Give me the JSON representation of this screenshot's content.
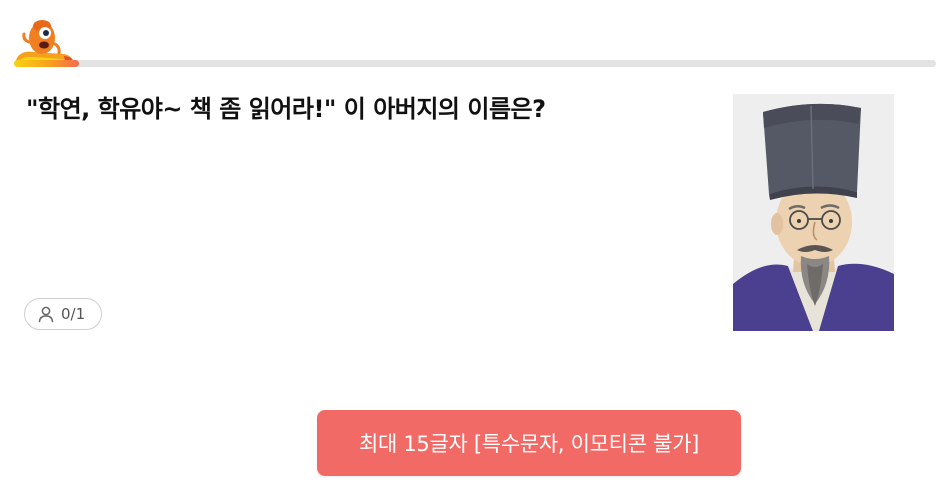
{
  "header": {
    "mascot_icon": "mascot-character-icon",
    "progress": {
      "value": 0.07,
      "colors": [
        "#f8d313",
        "#f7a01c",
        "#f56b4e"
      ],
      "track_color": "#e3e3e3"
    }
  },
  "question": {
    "text": "\"학연, 학유야~ 책 좀 읽어라!\" 이 아버지의 이름은?"
  },
  "answers": {
    "icon": "user-icon",
    "count": "0/1"
  },
  "portrait": {
    "icon": "scholar-portrait-icon"
  },
  "submit": {
    "label": "최대 15글자 [특수문자, 이모티콘 불가]",
    "color": "#f26a66"
  }
}
